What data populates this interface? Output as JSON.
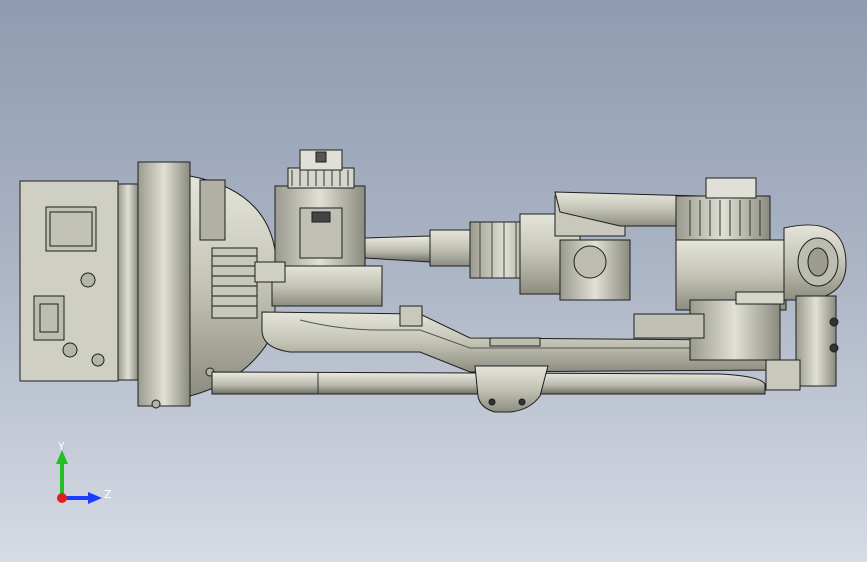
{
  "viewport": {
    "background_top": "#8f9bb0",
    "background_bottom": "#d6dbe4"
  },
  "model": {
    "description_icon": "robot-arm-model",
    "part_color": "#c8c8bc",
    "edge_color": "#1e1e1e"
  },
  "triad": {
    "y_label": "Y",
    "z_label": "Z",
    "y_color": "#22c022",
    "z_color": "#1a3cff",
    "origin_color": "#e02020"
  }
}
